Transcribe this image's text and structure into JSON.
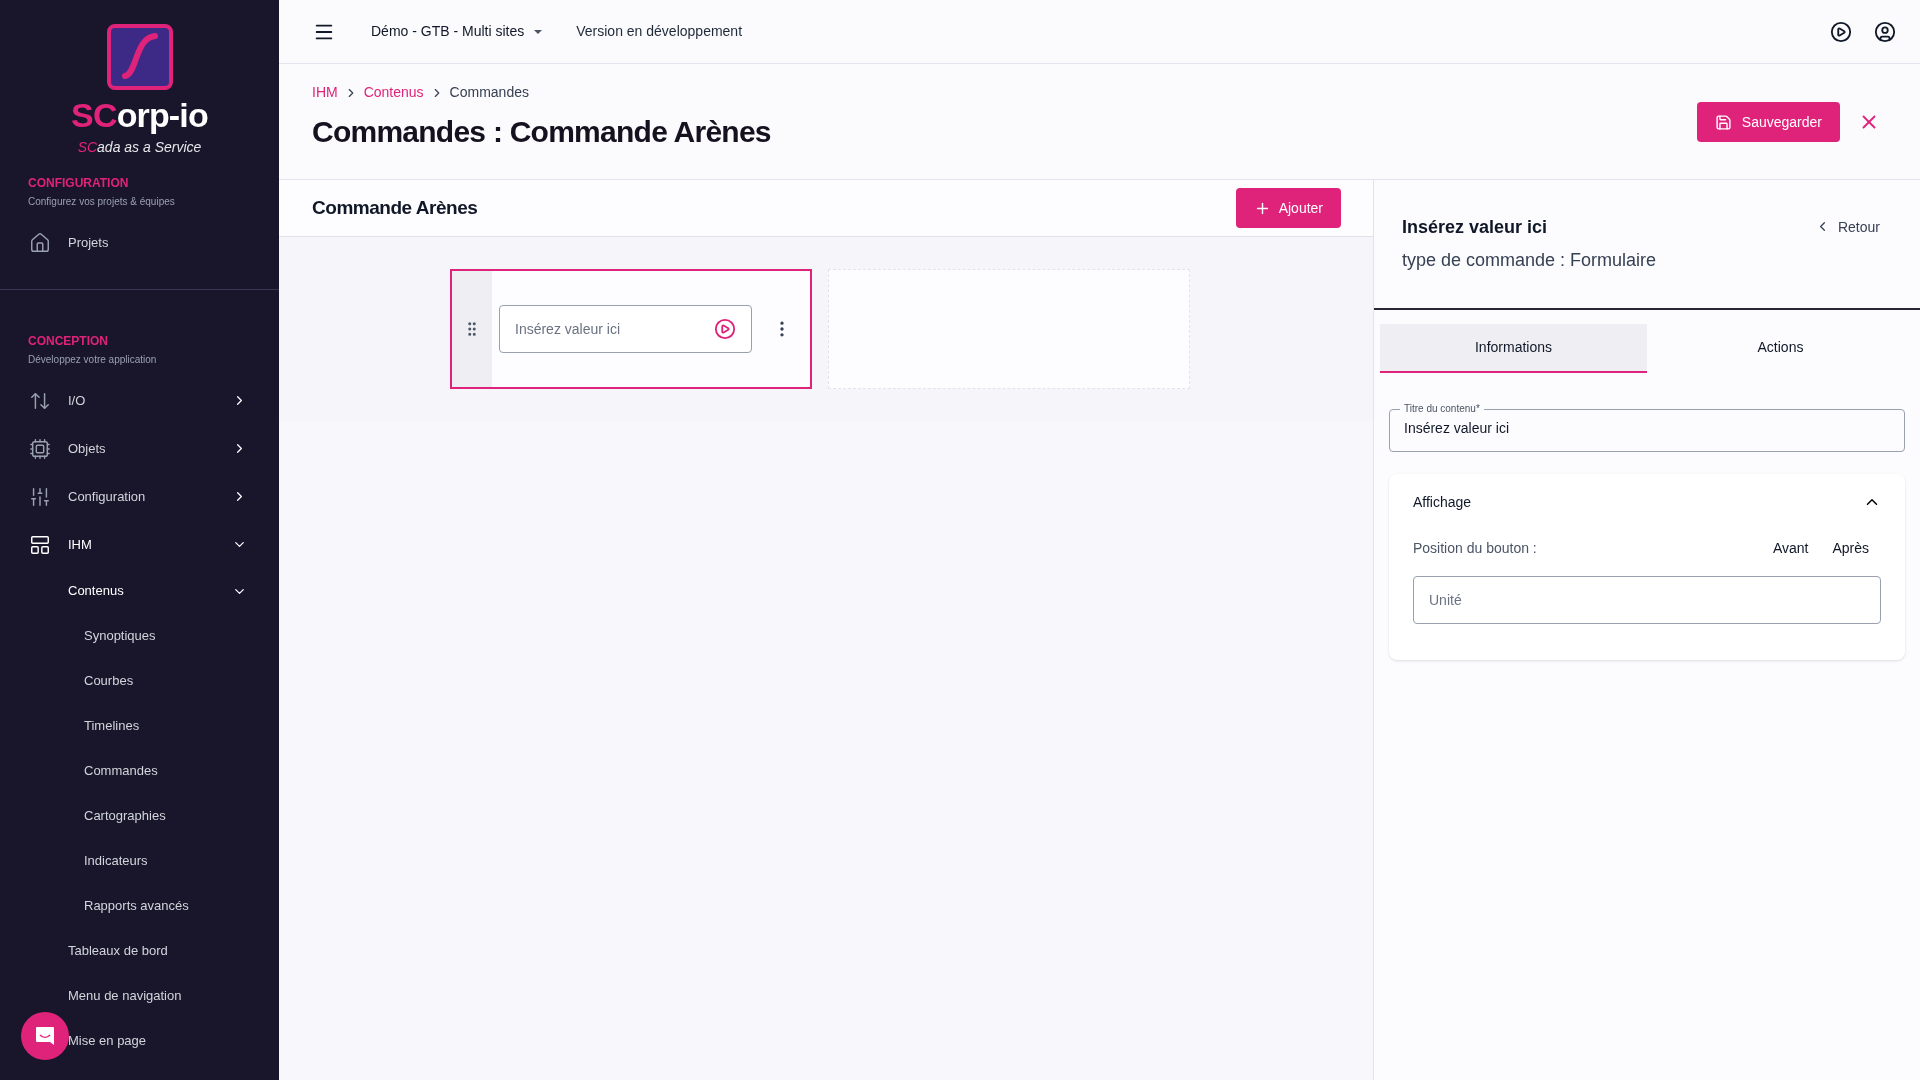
{
  "sidebar": {
    "logo": {
      "name_highlight": "SC",
      "name_rest": "orp-io",
      "tagline_highlight": "SC",
      "tagline_rest": "ada as a Service"
    },
    "sections": [
      {
        "title": "CONFIGURATION",
        "subtitle": "Configurez vos projets & équipes",
        "items": [
          {
            "label": "Projets"
          }
        ]
      },
      {
        "title": "CONCEPTION",
        "subtitle": "Développez votre application",
        "items": [
          {
            "label": "I/O",
            "expanded": false
          },
          {
            "label": "Objets",
            "expanded": false
          },
          {
            "label": "Configuration",
            "expanded": false
          },
          {
            "label": "IHM",
            "expanded": true,
            "children": [
              {
                "label": "Contenus",
                "expanded": true,
                "children": [
                  {
                    "label": "Synoptiques"
                  },
                  {
                    "label": "Courbes"
                  },
                  {
                    "label": "Timelines"
                  },
                  {
                    "label": "Commandes"
                  },
                  {
                    "label": "Cartographies"
                  },
                  {
                    "label": "Indicateurs"
                  },
                  {
                    "label": "Rapports avancés"
                  }
                ]
              },
              {
                "label": "Tableaux de bord"
              },
              {
                "label": "Menu de navigation"
              },
              {
                "label": "Mise en page"
              }
            ]
          }
        ]
      }
    ]
  },
  "topbar": {
    "project": "Démo - GTB - Multi sites",
    "version": "Version en développement"
  },
  "breadcrumb": [
    "IHM",
    "Contenus",
    "Commandes"
  ],
  "page": {
    "title": "Commandes : Commande Arènes",
    "save": "Sauvegarder"
  },
  "editor": {
    "title": "Commande Arènes",
    "add": "Ajouter",
    "blocks": [
      {
        "kind": "command",
        "selected": true,
        "placeholder": "Insérez valeur ici"
      },
      {
        "kind": "empty",
        "selected": false
      }
    ]
  },
  "panel": {
    "title": "Insérez valeur ici",
    "subtitle": "type de commande : Formulaire",
    "back": "Retour",
    "tabs": [
      {
        "label": "Informations",
        "selected": true
      },
      {
        "label": "Actions",
        "selected": false
      }
    ],
    "title_field": {
      "label": "Titre du contenu*",
      "value": "Insérez valeur ici"
    },
    "section": {
      "title": "Affichage",
      "expanded": true,
      "position_label": "Position du bouton :",
      "options": [
        {
          "label": "Avant",
          "selected": false
        },
        {
          "label": "Après",
          "selected": false
        }
      ],
      "unit_field": {
        "placeholder": "Unité"
      }
    }
  }
}
